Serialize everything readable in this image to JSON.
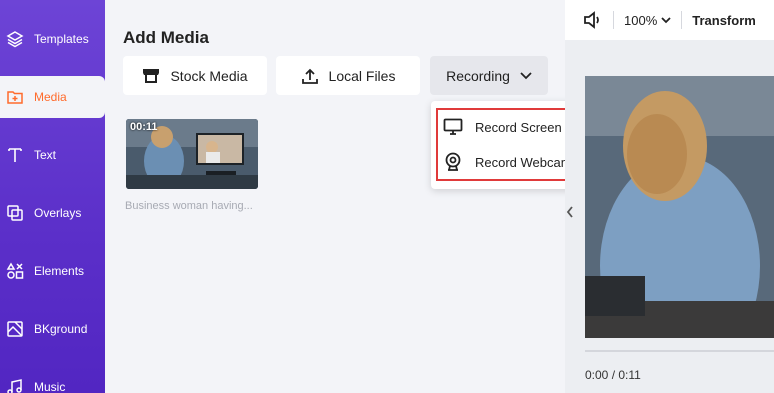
{
  "sidebar": {
    "items": [
      {
        "label": "Templates",
        "icon": "layers-icon"
      },
      {
        "label": "Media",
        "icon": "media-folder-icon",
        "active": true
      },
      {
        "label": "Text",
        "icon": "text-icon"
      },
      {
        "label": "Overlays",
        "icon": "overlays-icon"
      },
      {
        "label": "Elements",
        "icon": "elements-icon"
      },
      {
        "label": "BKground",
        "icon": "background-icon"
      },
      {
        "label": "Music",
        "icon": "music-icon"
      }
    ]
  },
  "panel": {
    "title": "Add Media",
    "buttons": {
      "stock": "Stock Media",
      "local": "Local Files",
      "recording": "Recording"
    },
    "media": [
      {
        "duration": "00:11",
        "caption": "Business woman having..."
      }
    ]
  },
  "dropdown": {
    "items": [
      {
        "label": "Record Screen",
        "icon": "monitor-icon"
      },
      {
        "label": "Record Webcam",
        "icon": "webcam-icon"
      }
    ]
  },
  "preview": {
    "zoom": "100%",
    "transform": "Transform",
    "time": "0:00 / 0:11"
  },
  "colors": {
    "sidebar": "#5b2fc9",
    "accent": "#ff6b2c",
    "highlight": "#e03a3a"
  }
}
